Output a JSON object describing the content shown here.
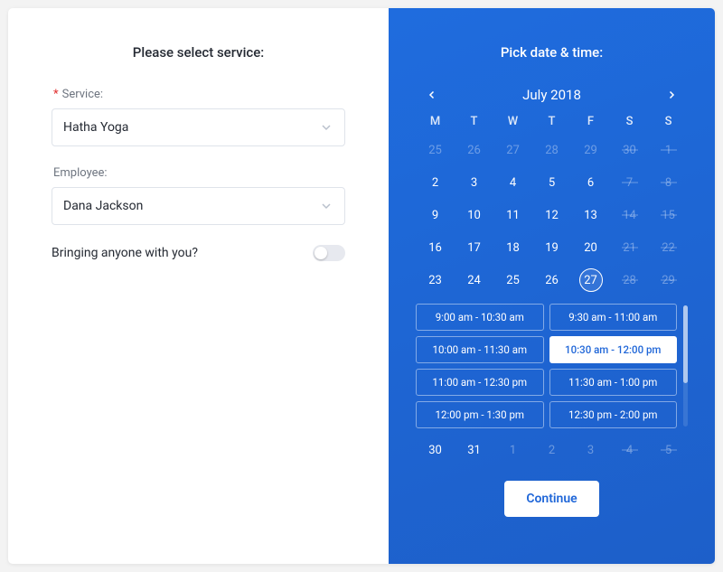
{
  "left": {
    "title": "Please select service:",
    "service": {
      "label": "Service:",
      "required": true,
      "value": "Hatha Yoga"
    },
    "employee": {
      "label": "Employee:",
      "required": false,
      "value": "Dana Jackson"
    },
    "bring": {
      "label": "Bringing anyone with you?",
      "on": false
    }
  },
  "right": {
    "title": "Pick date & time:",
    "month_label": "July 2018",
    "weekdays": [
      "M",
      "T",
      "W",
      "T",
      "F",
      "S",
      "S"
    ],
    "weeks_before": [
      [
        {
          "n": 25,
          "other": true
        },
        {
          "n": 26,
          "other": true
        },
        {
          "n": 27,
          "other": true
        },
        {
          "n": 28,
          "other": true
        },
        {
          "n": 29,
          "other": true
        },
        {
          "n": 30,
          "other": true,
          "strike": true
        },
        {
          "n": 1,
          "strike": true,
          "disabled": true
        }
      ],
      [
        {
          "n": 2
        },
        {
          "n": 3
        },
        {
          "n": 4
        },
        {
          "n": 5
        },
        {
          "n": 6
        },
        {
          "n": 7,
          "strike": true,
          "disabled": true
        },
        {
          "n": 8,
          "strike": true,
          "disabled": true
        }
      ],
      [
        {
          "n": 9
        },
        {
          "n": 10
        },
        {
          "n": 11
        },
        {
          "n": 12
        },
        {
          "n": 13
        },
        {
          "n": 14,
          "strike": true,
          "disabled": true
        },
        {
          "n": 15,
          "strike": true,
          "disabled": true
        }
      ],
      [
        {
          "n": 16
        },
        {
          "n": 17
        },
        {
          "n": 18
        },
        {
          "n": 19
        },
        {
          "n": 20
        },
        {
          "n": 21,
          "strike": true,
          "disabled": true
        },
        {
          "n": 22,
          "strike": true,
          "disabled": true
        }
      ],
      [
        {
          "n": 23
        },
        {
          "n": 24
        },
        {
          "n": 25
        },
        {
          "n": 26
        },
        {
          "n": 27,
          "selected": true
        },
        {
          "n": 28,
          "strike": true,
          "disabled": true
        },
        {
          "n": 29,
          "strike": true,
          "disabled": true
        }
      ]
    ],
    "time_slots": [
      {
        "label": "9:00 am - 10:30 am"
      },
      {
        "label": "9:30 am - 11:00 am"
      },
      {
        "label": "10:00 am - 11:30 am"
      },
      {
        "label": "10:30 am - 12:00 pm",
        "selected": true
      },
      {
        "label": "11:00 am - 12:30 pm"
      },
      {
        "label": "11:30 am - 1:00 pm"
      },
      {
        "label": "12:00 pm - 1:30 pm"
      },
      {
        "label": "12:30 pm - 2:00 pm"
      }
    ],
    "week_after": [
      {
        "n": 30
      },
      {
        "n": 31
      },
      {
        "n": 1,
        "other": true
      },
      {
        "n": 2,
        "other": true
      },
      {
        "n": 3,
        "other": true
      },
      {
        "n": 4,
        "other": true,
        "strike": true
      },
      {
        "n": 5,
        "other": true,
        "strike": true
      }
    ],
    "continue_label": "Continue"
  }
}
